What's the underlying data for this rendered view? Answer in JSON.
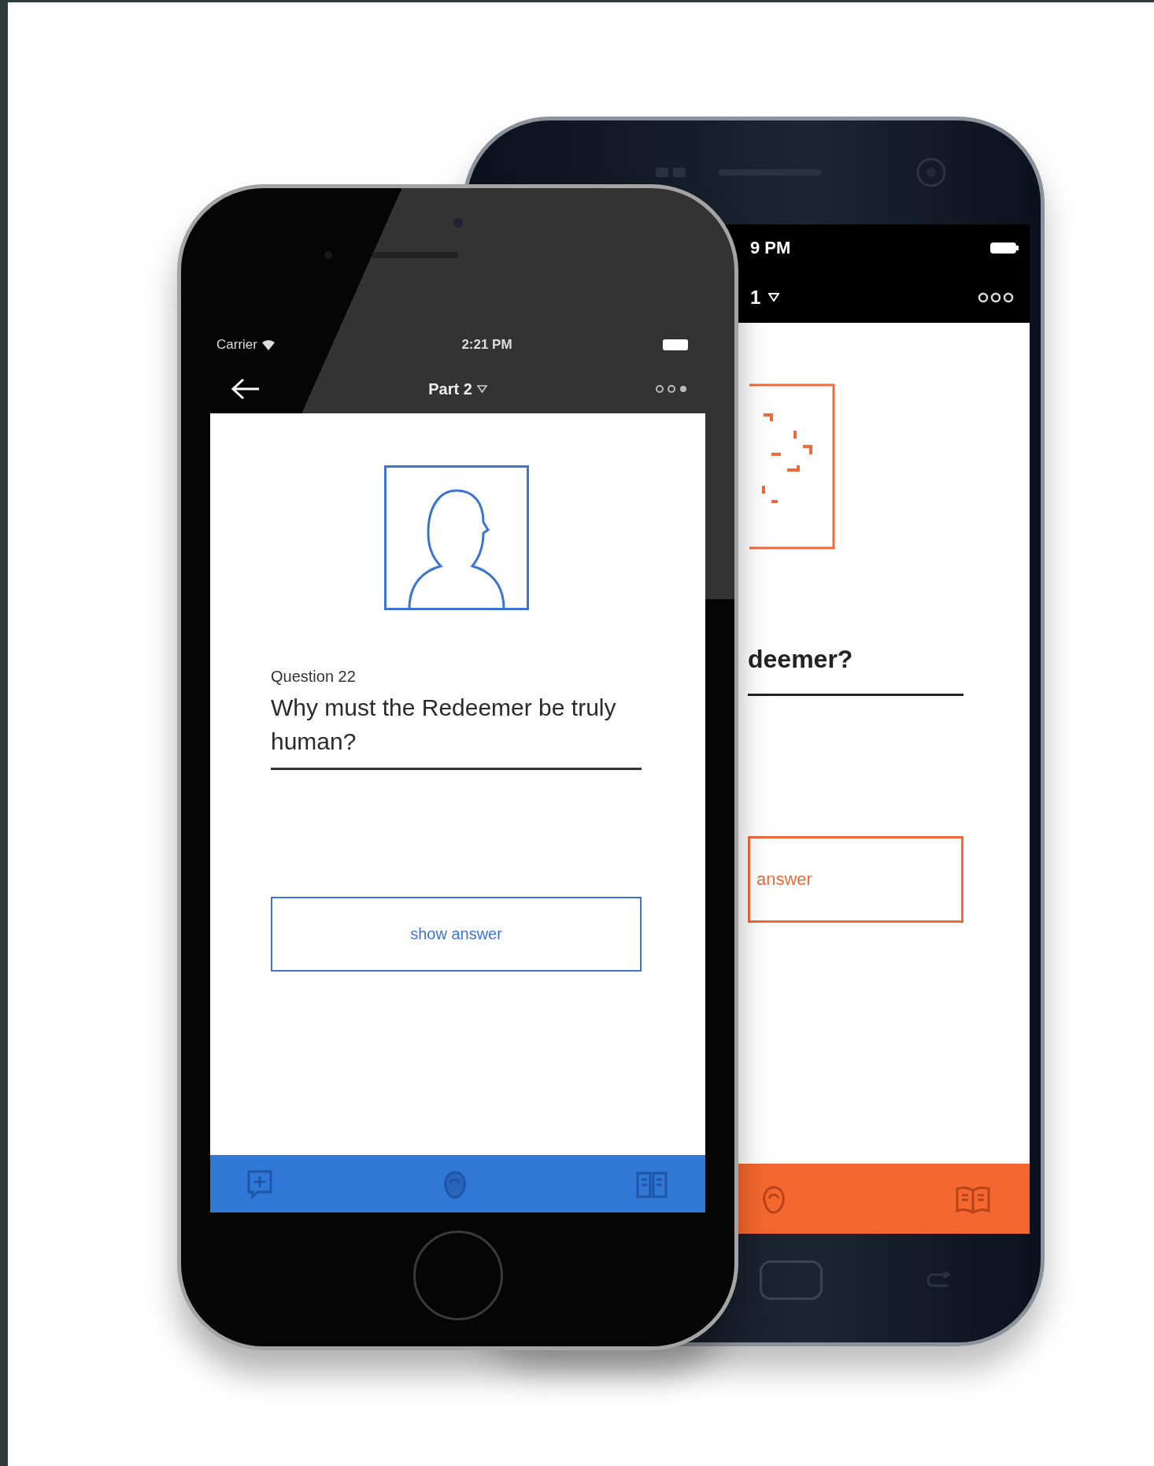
{
  "front_phone": {
    "status_bar": {
      "carrier": "Carrier",
      "time": "2:21 PM"
    },
    "nav": {
      "title": "Part 2"
    },
    "question": {
      "label": "Question 22",
      "text": "Why must the Redeemer be truly human?"
    },
    "button": "show answer"
  },
  "back_phone": {
    "status_bar": {
      "time": "9 PM"
    },
    "nav": {
      "title": "1"
    },
    "question": {
      "text": "deemer?"
    },
    "button": "answer"
  }
}
